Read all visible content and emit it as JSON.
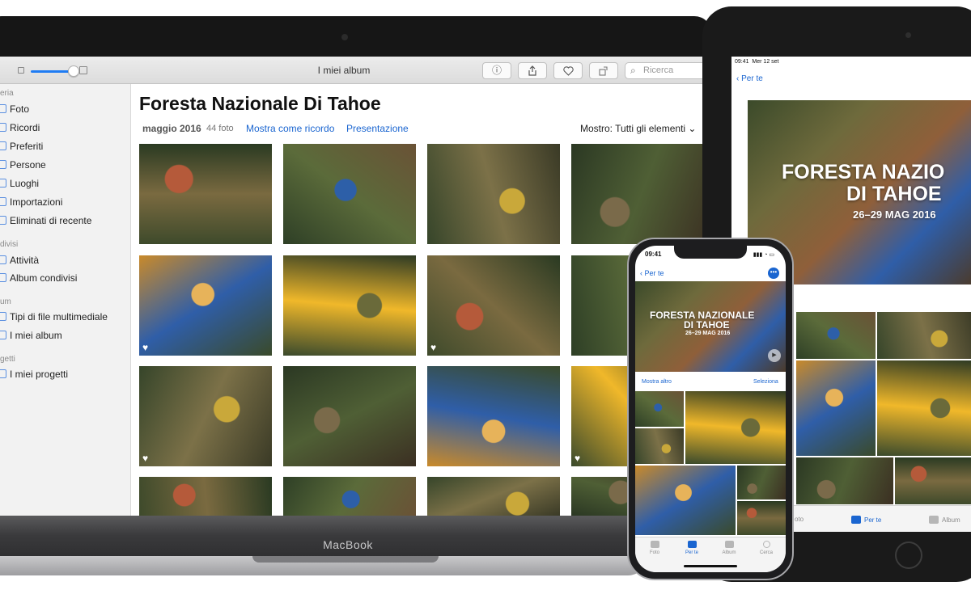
{
  "mac": {
    "brand": "MacBook",
    "toolbar": {
      "title": "I miei album",
      "info_icon": "ⓘ",
      "search_placeholder": "Ricerca"
    },
    "sidebar": {
      "section1": "eria",
      "items1": [
        "Foto",
        "Ricordi",
        "Preferiti",
        "Persone",
        "Luoghi",
        "Importazioni",
        "Eliminati di recente"
      ],
      "section2": "divisi",
      "items2": [
        "Attività",
        "Album condivisi"
      ],
      "section3": "um",
      "items3": [
        "Tipi di file multimediale",
        "I miei album"
      ],
      "section4": "getti",
      "items4": [
        "I miei progetti"
      ]
    },
    "album": {
      "title": "Foresta Nazionale Di Tahoe",
      "date": "maggio 2016",
      "count": "44 foto",
      "memory_link": "Mostra come ricordo",
      "slideshow_link": "Presentazione",
      "show_label": "Mostro:",
      "show_value": "Tutti gli elementi"
    }
  },
  "ipad": {
    "status_time": "09:41",
    "status_date": "Mer 12 set",
    "back": "Per te",
    "hero_title_line1": "FORESTA NAZIO",
    "hero_title_line2": "DI TAHOE",
    "hero_date": "26–29 MAG 2016",
    "tabs": [
      "oto",
      "Per te",
      "Album"
    ]
  },
  "iphone": {
    "status_time": "09:41",
    "back": "Per te",
    "more": "•••",
    "hero_title_line1": "FORESTA NAZIONALE",
    "hero_title_line2": "DI TAHOE",
    "hero_date": "26–29 MAG 2016",
    "show_more": "Mostra altro",
    "select": "Seleziona",
    "tabs": [
      "Foto",
      "Per te",
      "Album",
      "Cerca"
    ]
  },
  "colors": {
    "accent": "#1a65d0",
    "slider": "#1f7cf3"
  }
}
